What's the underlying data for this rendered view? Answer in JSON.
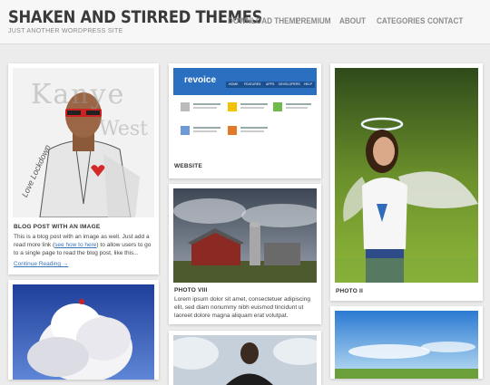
{
  "site": {
    "title": "SHAKEN AND STIRRED THEMES",
    "tagline": "JUST ANOTHER WORDPRESS SITE"
  },
  "nav": [
    {
      "label": "DOWNLOAD THEME"
    },
    {
      "label": "PREMIUM"
    },
    {
      "label": "ABOUT"
    },
    {
      "label": "CATEGORIES"
    },
    {
      "label": "CONTACT"
    }
  ],
  "posts": {
    "blog": {
      "title": "BLOG POST WITH AN IMAGE",
      "text_before": "This is a blog post with an image as well. Just add a read more link (",
      "link_text": "see how to here",
      "text_after": ") to allow users to go to a single page to read the blog post, like this...",
      "continue": "Continue Reading →",
      "image_text_1": "Kanye",
      "image_text_2": "West",
      "image_text_3": "Love Lockdown"
    },
    "website": {
      "title": "WEBSITE",
      "logo_text": "revoice",
      "tabs": [
        "HOME",
        "FEATURES",
        "APPS",
        "DEVELOPERS",
        "HELP"
      ]
    },
    "photo8": {
      "title": "PHOTO VIII",
      "text": "Lorem ipsum dolor sit amet, consectetuer adipiscing elit, sed diam nonummy nibh euismod tincidunt ut laoreet dolore magna aliquam erat volutpat."
    },
    "photo2": {
      "title": "PHOTO II"
    }
  },
  "colors": {
    "background": "#ececec",
    "link": "#3a74b8",
    "title": "#3a3a3a",
    "nav": "#8c8c8c"
  }
}
